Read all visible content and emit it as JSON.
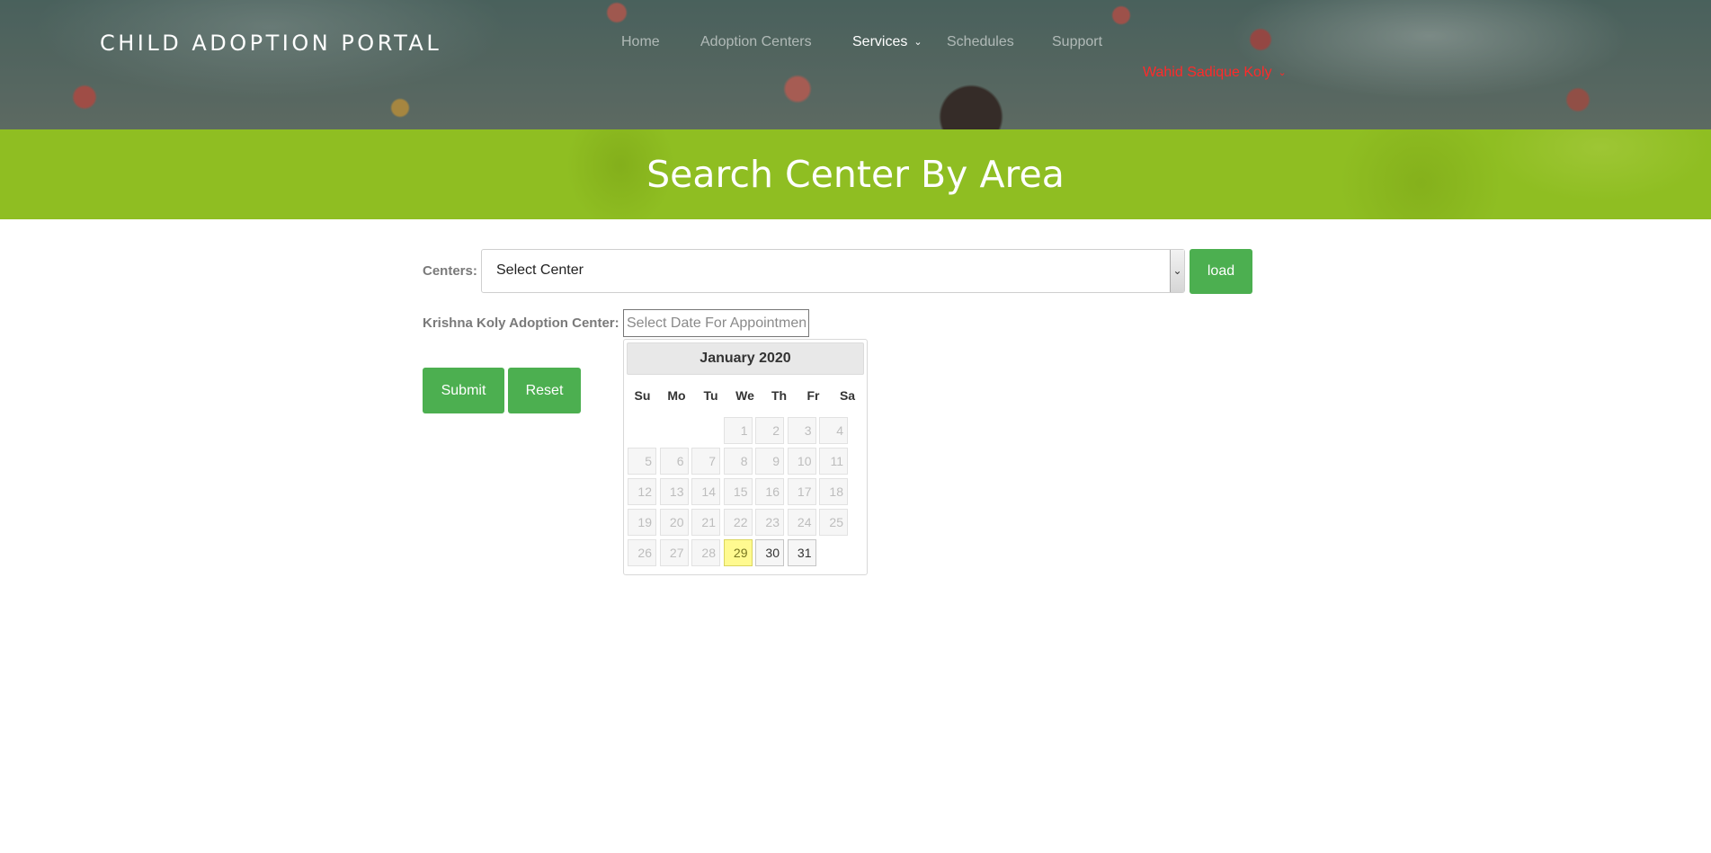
{
  "header": {
    "brand": "CHILD ADOPTION PORTAL",
    "nav": {
      "home": "Home",
      "adoption_centers": "Adoption Centers",
      "services": "Services",
      "schedules": "Schedules",
      "support": "Support"
    },
    "user": "Wahid Sadique Koly"
  },
  "banner": {
    "title": "Search Center By Area"
  },
  "form": {
    "centers_label": "Centers:",
    "centers_select_value": "Select Center",
    "load_button": "load",
    "center_name_label": "Krishna Koly Adoption Center:",
    "date_placeholder": "Select Date For Appointment",
    "submit_button": "Submit",
    "reset_button": "Reset"
  },
  "datepicker": {
    "month_label": "January 2020",
    "weekdays": [
      "Su",
      "Mo",
      "Tu",
      "We",
      "Th",
      "Fr",
      "Sa"
    ],
    "first_weekday_index": 3,
    "days_in_month": 31,
    "today": 29,
    "selectable_days": [
      29,
      30,
      31
    ]
  },
  "colors": {
    "accent_green": "#4caf50",
    "banner_green": "#8fbe22",
    "user_red": "#ff2a2a",
    "today_highlight": "#fffa90"
  }
}
